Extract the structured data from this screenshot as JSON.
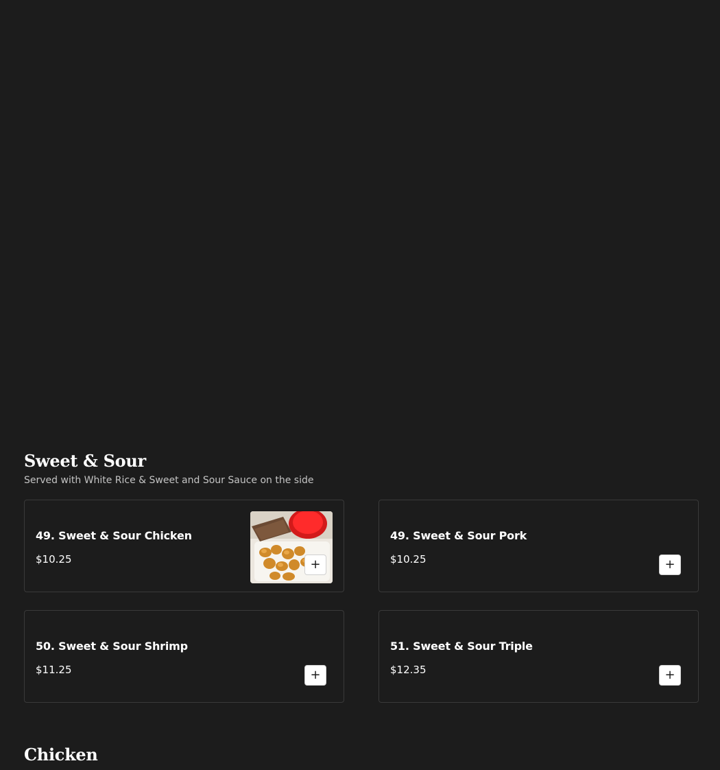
{
  "sections": [
    {
      "title": "Sweet & Sour",
      "subtitle": "Served with White Rice & Sweet and Sour Sauce on the side",
      "items": [
        {
          "name": "49. Sweet & Sour Chicken",
          "price": "$10.25",
          "has_image": true,
          "add_icon": "plus-icon"
        },
        {
          "name": "49. Sweet & Sour Pork",
          "price": "$10.25",
          "has_image": false,
          "add_icon": "plus-icon"
        },
        {
          "name": "50. Sweet & Sour Shrimp",
          "price": "$11.25",
          "has_image": false,
          "add_icon": "plus-icon"
        },
        {
          "name": "51. Sweet & Sour Triple",
          "price": "$12.35",
          "has_image": false,
          "add_icon": "plus-icon"
        }
      ]
    },
    {
      "title": "Chicken"
    }
  ],
  "colors": {
    "background": "#1c1c1c",
    "card_border": "#3a3a3a",
    "text": "#ffffff",
    "subtext": "#c4c4c4",
    "button_bg": "#ffffff"
  }
}
